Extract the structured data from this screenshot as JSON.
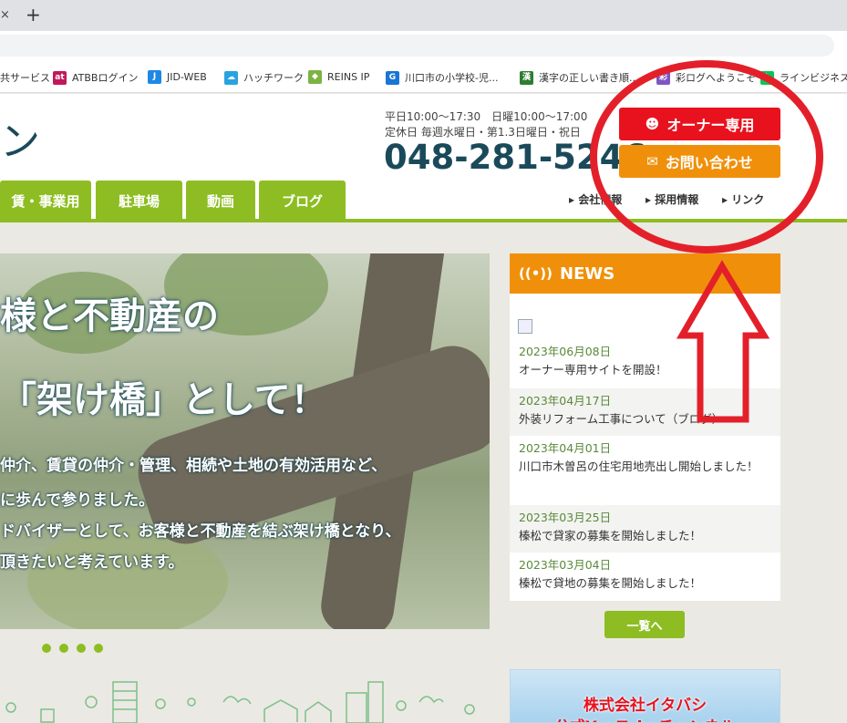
{
  "browser": {
    "tab_close_glyph": "×",
    "new_tab_glyph": "+",
    "bookmarks": [
      {
        "label": "共サービス",
        "icon": "none"
      },
      {
        "label": "ATBBログイン",
        "icon": "at-icon",
        "badge": "at",
        "color": "#c2185b"
      },
      {
        "label": "JID-WEB",
        "icon": "j-icon",
        "badge": "J",
        "color": "#1e88e5"
      },
      {
        "label": "ハッチワーク",
        "icon": "cloud-icon",
        "badge": "☁",
        "color": "#29a3e0"
      },
      {
        "label": "REINS IP",
        "icon": "diamond-icon",
        "badge": "◆",
        "color": "#7cb342"
      },
      {
        "label": "川口市の小学校-児...",
        "icon": "g-icon",
        "badge": "G",
        "color": "#1976d2"
      },
      {
        "label": "漢字の正しい書き順...",
        "icon": "kanji-icon",
        "badge": "漢",
        "color": "#2e7d32"
      },
      {
        "label": "彩ログへようこそ",
        "icon": "ayalog-icon",
        "badge": "彩",
        "color": "#7e57c2"
      },
      {
        "label": "ラインビジネス",
        "icon": "line-icon",
        "badge": "L",
        "color": "#06c755"
      }
    ]
  },
  "header": {
    "logo_fragment": "ン",
    "hours_line1": "平日10:00～17:30　日曜10:00～17:00",
    "hours_line2": "定休日 毎週水曜日・第1.3日曜日・祝日",
    "phone": "048-281-5246",
    "owner_button": "オーナー専用",
    "contact_button": "お問い合わせ",
    "sublinks": [
      "会社情報",
      "採用情報",
      "リンク"
    ],
    "nav_tabs": [
      "賃・事業用",
      "駐車場",
      "動画",
      "ブログ"
    ]
  },
  "hero": {
    "heading_line1": "様と不動産の",
    "heading_line2": "「架け橋」として！",
    "body_lines": [
      "仲介、賃貸の仲介・管理、相続や土地の有効活用など、",
      "に歩んで参りました。",
      "ドバイザーとして、お客様と不動産を結ぶ架け橋となり、",
      "頂きたいと考えています。"
    ],
    "slide_count": 4
  },
  "news": {
    "title": "NEWS",
    "items": [
      {
        "date": "2023年06月08日",
        "title": "オーナー専用サイトを開設！"
      },
      {
        "date": "2023年04月17日",
        "title": "外装リフォーム工事について（ブログ）"
      },
      {
        "date": "2023年04月01日",
        "title": "川口市木曽呂の住宅用地売出し開始しました！"
      },
      {
        "date": "2023年03月25日",
        "title": "榛松で貸家の募集を開始しました！"
      },
      {
        "date": "2023年03月04日",
        "title": "榛松で貸地の募集を開始しました！"
      }
    ],
    "more_button": "一覧へ"
  },
  "youtube_banner": {
    "line1": "株式会社イタバシ",
    "line2": "公式YouTubeチャンネル"
  },
  "colors": {
    "brand_green": "#8dbd22",
    "owner_red": "#e8121e",
    "contact_orange": "#f0900a",
    "annotation_red": "#e3202a"
  }
}
